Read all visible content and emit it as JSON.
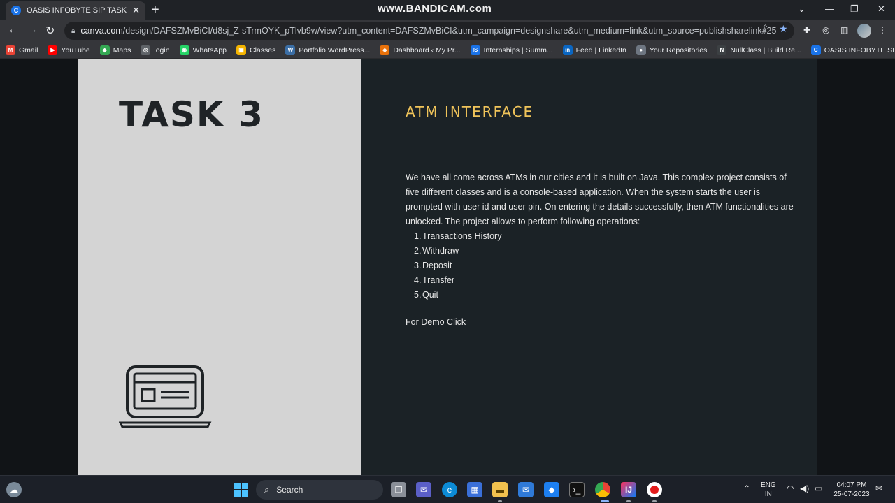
{
  "browser": {
    "watermark": "www.BANDICAM.com",
    "tab": {
      "title": "OASIS INFOBYTE SIP TASK LIST",
      "favicon": "C"
    },
    "url_domain": "canva.com",
    "url_path": "/design/DAFSZMvBiCI/d8sj_Z-sTrmOYK_pTlvb9w/view?utm_content=DAFSZMvBiCI&utm_campaign=designshare&utm_medium=link&utm_source=publishsharelink#25",
    "bookmarks": [
      {
        "label": "Gmail",
        "icon": "M",
        "color": "#ea4335"
      },
      {
        "label": "YouTube",
        "icon": "▶",
        "color": "#ff0000"
      },
      {
        "label": "Maps",
        "icon": "◆",
        "color": "#34a853"
      },
      {
        "label": "login",
        "icon": "◎",
        "color": "#5f6368"
      },
      {
        "label": "WhatsApp",
        "icon": "◉",
        "color": "#25d366"
      },
      {
        "label": "Classes",
        "icon": "▣",
        "color": "#f4b400"
      },
      {
        "label": "Portfolio WordPress...",
        "icon": "W",
        "color": "#3b6ea5"
      },
      {
        "label": "Dashboard ‹ My Pr...",
        "icon": "◈",
        "color": "#e8710a"
      },
      {
        "label": "Internships | Summ...",
        "icon": "IS",
        "color": "#1a73e8"
      },
      {
        "label": "Feed | LinkedIn",
        "icon": "in",
        "color": "#0a66c2"
      },
      {
        "label": "Your Repositories",
        "icon": "●",
        "color": "#6e7681"
      },
      {
        "label": "NullClass | Build Re...",
        "icon": "N",
        "color": "#3c4043"
      },
      {
        "label": "OASIS INFOBYTE SI...",
        "icon": "C",
        "color": "#1a73e8"
      }
    ]
  },
  "slide": {
    "task_title": "TASK 3",
    "heading": "ATM INTERFACE",
    "description": "We have all come across ATMs in our cities and it is built on Java. This complex project consists of five different classes and is a console-based application. When the system starts the user is prompted with user id and user pin. On entering the details successfully, then ATM functionalities are unlocked. The project allows to perform following operations:",
    "operations": [
      {
        "num": "1.",
        "label": "Transactions History"
      },
      {
        "num": "2.",
        "label": "Withdraw"
      },
      {
        "num": "3.",
        "label": "Deposit"
      },
      {
        "num": "4.",
        "label": "Transfer"
      },
      {
        "num": "5.",
        "label": "Quit"
      }
    ],
    "demo_text": "For Demo Click",
    "heading_color": "#f0c45a"
  },
  "taskbar": {
    "search_label": "Search",
    "lang_line1": "ENG",
    "lang_line2": "IN",
    "time": "04:07 PM",
    "date": "25-07-2023"
  }
}
